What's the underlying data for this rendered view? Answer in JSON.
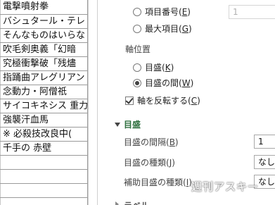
{
  "sheet": {
    "cells": [
      "電撃噴射拳",
      "バシュタール・テレ",
      "そんなものはいらな",
      "吹毛剣奥義「幻暗",
      "究極衝撃破「残燼",
      "指踊曲アレグリアン",
      "念動力・阿僧祇",
      "サイコキネシス 重力",
      "強襲汗血馬",
      "※ 必殺技改良中(",
      "千手の 赤壁",
      "",
      "",
      "",
      ""
    ]
  },
  "pane": {
    "item_number_label": "項目番号(",
    "item_number_key": "E",
    "item_number_value": "1",
    "max_item_label": "最大項目(",
    "max_item_key": "G",
    "axis_position_heading": "軸位置",
    "on_tick_label": "目盛(",
    "on_tick_key": "K",
    "between_ticks_label": "目盛の間(",
    "between_ticks_key": "W",
    "reverse_label": "軸を反転する(",
    "reverse_key": "C",
    "tick_section_title": "目盛",
    "tick_interval_label": "目盛の間隔(",
    "tick_interval_key": "B",
    "tick_interval_value": "1",
    "major_tick_label": "目盛の種類(",
    "major_tick_key": "J",
    "major_tick_value": "なし",
    "minor_tick_label": "補助目盛の種類(",
    "minor_tick_key": "I",
    "minor_tick_value": "なし",
    "next_section_title": "ラベル",
    "close_paren": ")"
  },
  "watermark": "週刊アスキー",
  "colors": {
    "section_title": "#2e6f3e",
    "gridline": "#9a9a9a"
  }
}
